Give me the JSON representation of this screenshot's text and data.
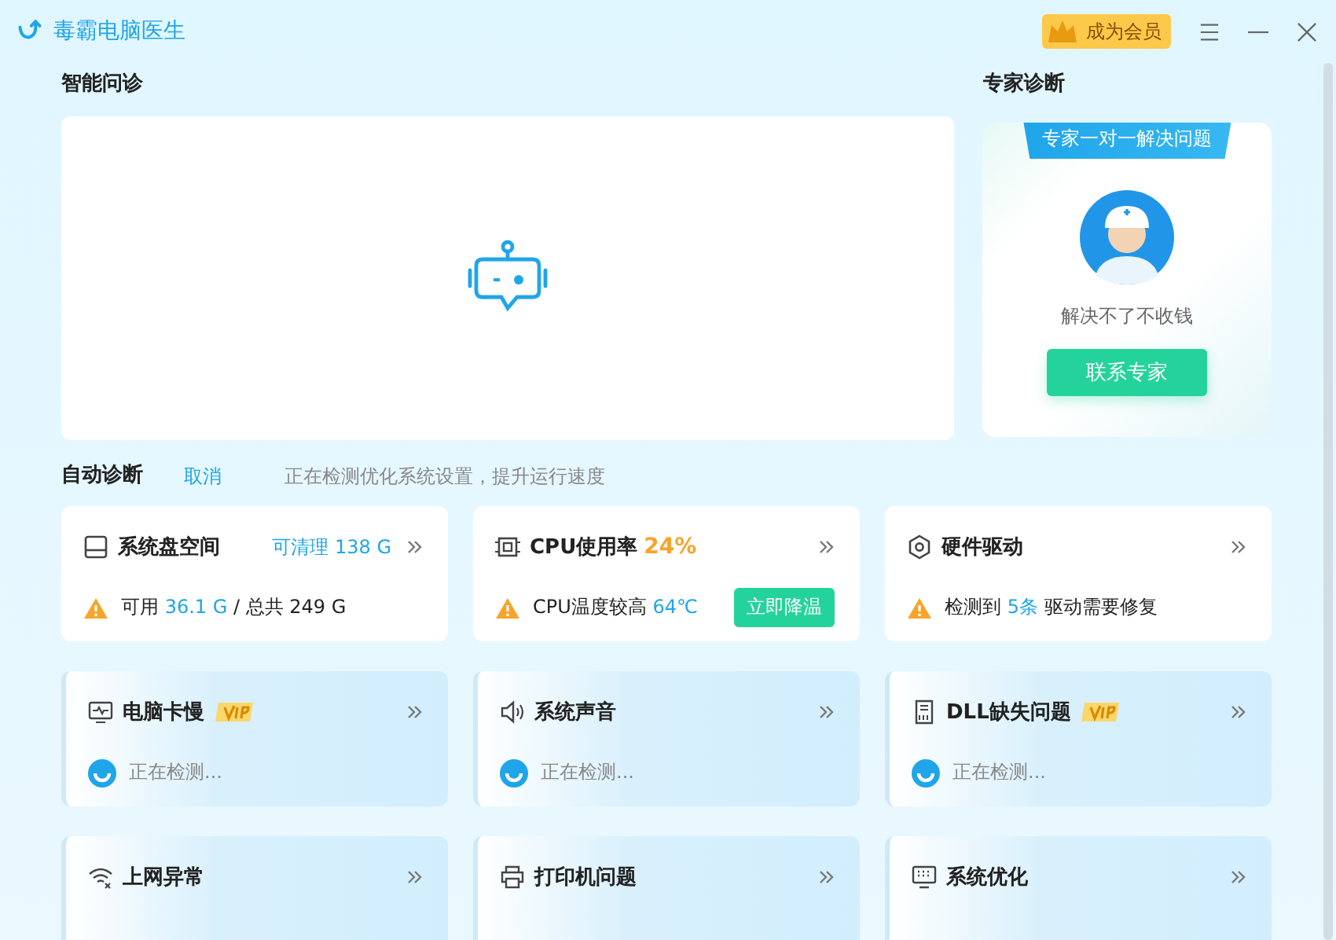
{
  "app": {
    "title": "毒霸电脑医生",
    "vip_button": "成为会员"
  },
  "smart_consult": {
    "heading": "智能问诊"
  },
  "expert": {
    "heading": "专家诊断",
    "banner": "专家一对一解决问题",
    "slogan": "解决不了不收钱",
    "button": "联系专家"
  },
  "auto_diagnosis": {
    "heading": "自动诊断",
    "cancel": "取消",
    "status": "正在检测优化系统设置，提升运行速度"
  },
  "result_cards": [
    {
      "kind": "disk",
      "title": "系统盘空间",
      "extra": "可清理 138 G",
      "line": [
        {
          "text": "可用 ",
          "highlight": false
        },
        {
          "text": "36.1 G",
          "highlight": true
        },
        {
          "text": " / 总共 249 G",
          "highlight": false
        }
      ]
    },
    {
      "kind": "cpu",
      "title": "CPU使用率",
      "value": "24%",
      "line": [
        {
          "text": "CPU温度较高 ",
          "highlight": false
        },
        {
          "text": "64℃",
          "highlight": true
        }
      ],
      "button": "立即降温"
    },
    {
      "kind": "hardware",
      "title": "硬件驱动",
      "line": [
        {
          "text": "检测到 ",
          "highlight": false
        },
        {
          "text": "5条",
          "highlight": true
        },
        {
          "text": " 驱动需要修复",
          "highlight": false
        }
      ]
    }
  ],
  "check_cards": [
    {
      "kind": "monitor",
      "title": "电脑卡慢",
      "vip": true,
      "status": "正在检测..."
    },
    {
      "kind": "speaker",
      "title": "系统声音",
      "vip": false,
      "status": "正在检测..."
    },
    {
      "kind": "dll",
      "title": "DLL缺失问题",
      "vip": true,
      "status": "正在检测..."
    },
    {
      "kind": "network",
      "title": "上网异常",
      "vip": false
    },
    {
      "kind": "printer",
      "title": "打印机问题",
      "vip": false
    },
    {
      "kind": "optimize",
      "title": "系统优化",
      "vip": false
    }
  ]
}
